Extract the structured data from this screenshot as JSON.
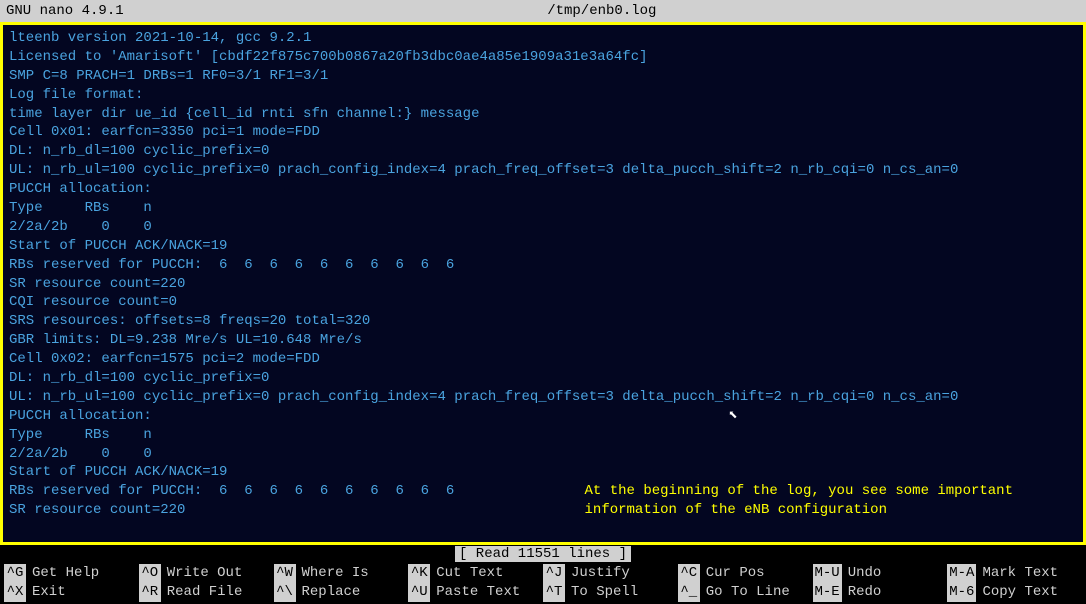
{
  "title_bar": {
    "app": "GNU nano 4.9.1",
    "file": "/tmp/enb0.log"
  },
  "log_lines": [
    "lteenb version 2021-10-14, gcc 9.2.1",
    "Licensed to 'Amarisoft' [cbdf22f875c700b0867a20fb3dbc0ae4a85e1909a31e3a64fc]",
    "SMP C=8 PRACH=1 DRBs=1 RF0=3/1 RF1=3/1",
    "Log file format:",
    "time layer dir ue_id {cell_id rnti sfn channel:} message",
    "Cell 0x01: earfcn=3350 pci=1 mode=FDD",
    "DL: n_rb_dl=100 cyclic_prefix=0",
    "UL: n_rb_ul=100 cyclic_prefix=0 prach_config_index=4 prach_freq_offset=3 delta_pucch_shift=2 n_rb_cqi=0 n_cs_an=0",
    "PUCCH allocation:",
    "Type     RBs    n",
    "2/2a/2b    0    0",
    "Start of PUCCH ACK/NACK=19",
    "RBs reserved for PUCCH:  6  6  6  6  6  6  6  6  6  6",
    "SR resource count=220",
    "CQI resource count=0",
    "SRS resources: offsets=8 freqs=20 total=320",
    "GBR limits: DL=9.238 Mre/s UL=10.648 Mre/s",
    "Cell 0x02: earfcn=1575 pci=2 mode=FDD",
    "DL: n_rb_dl=100 cyclic_prefix=0",
    "UL: n_rb_ul=100 cyclic_prefix=0 prach_config_index=4 prach_freq_offset=3 delta_pucch_shift=2 n_rb_cqi=0 n_cs_an=0",
    "PUCCH allocation:",
    "Type     RBs    n",
    "2/2a/2b    0    0",
    "Start of PUCCH ACK/NACK=19",
    "RBs reserved for PUCCH:  6  6  6  6  6  6  6  6  6  6",
    "SR resource count=220"
  ],
  "annotation": {
    "line1": "At the beginning of the log, you see some important",
    "line2": "information of the eNB configuration"
  },
  "status": "[ Read 11551 lines ]",
  "shortcuts": [
    {
      "key": "^G",
      "label": "Get Help"
    },
    {
      "key": "^O",
      "label": "Write Out"
    },
    {
      "key": "^W",
      "label": "Where Is"
    },
    {
      "key": "^K",
      "label": "Cut Text"
    },
    {
      "key": "^J",
      "label": "Justify"
    },
    {
      "key": "^C",
      "label": "Cur Pos"
    },
    {
      "key": "M-U",
      "label": "Undo"
    },
    {
      "key": "M-A",
      "label": "Mark Text"
    },
    {
      "key": "^X",
      "label": "Exit"
    },
    {
      "key": "^R",
      "label": "Read File"
    },
    {
      "key": "^\\",
      "label": "Replace"
    },
    {
      "key": "^U",
      "label": "Paste Text"
    },
    {
      "key": "^T",
      "label": "To Spell"
    },
    {
      "key": "^_",
      "label": "Go To Line"
    },
    {
      "key": "M-E",
      "label": "Redo"
    },
    {
      "key": "M-6",
      "label": "Copy Text"
    }
  ]
}
